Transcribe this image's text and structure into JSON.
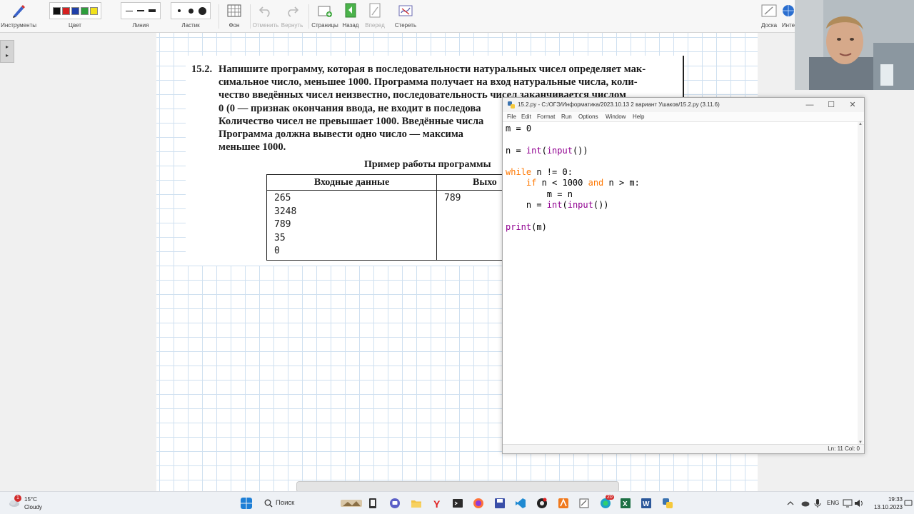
{
  "toolbar": {
    "tools_label": "Инструменты",
    "color_label": "Цвет",
    "line_label": "Линия",
    "eraser_label": "Ластик",
    "background_label": "Фон",
    "undo_label": "Отменить",
    "redo_label": "Вернуть",
    "pages_label": "Страницы",
    "back_label": "Назад",
    "forward_label": "Вперед",
    "erase_label": "Стереть",
    "board_label": "Доска",
    "interface_label": "Инте",
    "colors": [
      "#111111",
      "#d62020",
      "#1f3fa8",
      "#2e9e3c",
      "#f2e21c"
    ]
  },
  "sidebar_handle_label": "▸",
  "textbook": {
    "task_number": "15.2.",
    "task_lines": [
      "Напишите программу, которая в последовательности натуральных чисел определяет мак-",
      "симальное число, меньшее 1000. Программа получает на вход натуральные числа, коли-",
      "чество введённых чисел неизвестно, последовательность чисел заканчивается числом",
      "0 (0 — признак окончания ввода, не входит в последова",
      "Количество чисел не превышает 1000. Введённые числа",
      "Программа должна вывести одно число — максима",
      "меньшее 1000."
    ],
    "example_title": "Пример работы программы",
    "table_header_input": "Входные данные",
    "table_header_output": "Выхо",
    "input_values": [
      "265",
      "3248",
      "789",
      "35",
      "0"
    ],
    "output_values": [
      "789"
    ]
  },
  "idle": {
    "title": "15.2.py - C:/ОГЭ/Информатика/2023.10.13 2 вариант Ушаков/15.2.py (3.11.6)",
    "menu": [
      "File",
      "Edit",
      "Format",
      "Run",
      "Options",
      "Window",
      "Help"
    ],
    "code": {
      "l1": "m = 0",
      "l3_a": "n = ",
      "l3_int": "int",
      "l3_b": "(",
      "l3_input": "input",
      "l3_c": "())",
      "l5_while": "while",
      "l5_rest": " n != 0:",
      "l6_ind": "    ",
      "l6_if": "if",
      "l6_a": " n < 1000 ",
      "l6_and": "and",
      "l6_b": " n > m:",
      "l7": "        m = n",
      "l8_a": "    n = ",
      "l8_int": "int",
      "l8_b": "(",
      "l8_input": "input",
      "l8_c": "())",
      "l10_print": "print",
      "l10_rest": "(m)"
    },
    "status": "Ln: 11    Col: 0"
  },
  "taskbar": {
    "weather_badge": "1",
    "weather_temp": "15°C",
    "weather_condition": "Cloudy",
    "search_placeholder": "Поиск",
    "language": "ENG",
    "time": "19:33",
    "date": "13.10.2023",
    "firefox_badge": "20"
  }
}
